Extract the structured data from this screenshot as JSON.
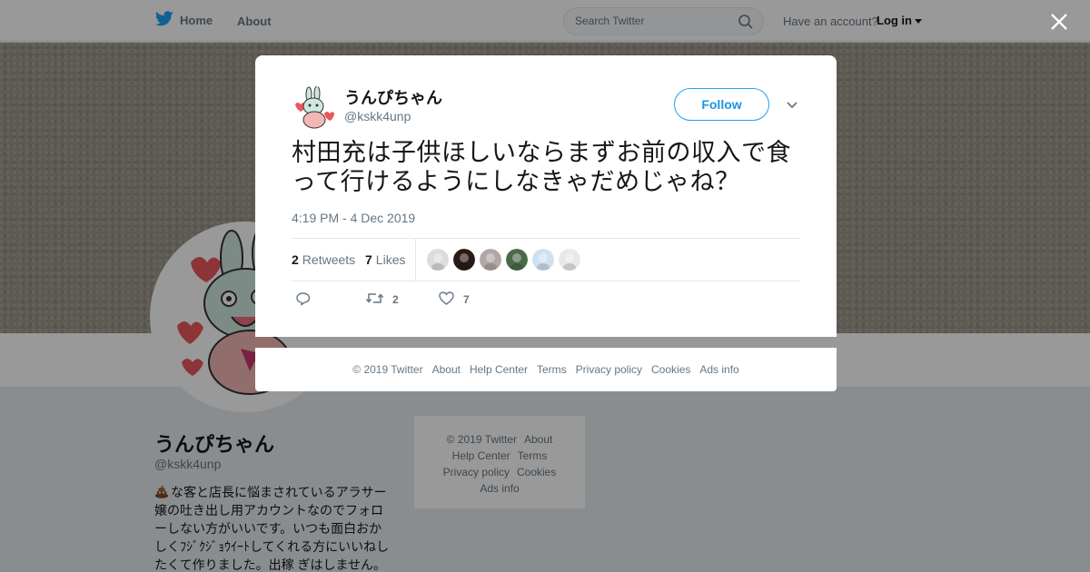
{
  "topbar": {
    "home_label": "Home",
    "about_label": "About",
    "search_placeholder": "Search Twitter",
    "account_prompt": "Have an account?",
    "login_label": "Log in"
  },
  "profile": {
    "name": "うんぴちゃん",
    "handle": "@kskk4unp",
    "bio": "な客と店長に悩まされているアラサー嬢の吐き出し用アカウントなのでフォローしない方がいいです。いつも面白おかしくﾌｼﾞｸｼﾞｮｳｲｰﾄしてくれる方にいいねしたくて作りました。出稼 ぎはしません。"
  },
  "side_footer": {
    "rows": [
      [
        "© 2019 Twitter",
        "About"
      ],
      [
        "Help Center",
        "Terms"
      ],
      [
        "Privacy policy",
        "Cookies"
      ],
      [
        "Ads info"
      ]
    ]
  },
  "tweet": {
    "author_name": "うんぴちゃん",
    "author_handle": "@kskk4unp",
    "follow_label": "Follow",
    "text": "村田充は子供ほしいならまずお前の収入で食って行けるようにしなきゃだめじゃね？",
    "timestamp": "4:19 PM - 4 Dec 2019",
    "retweets_count": "2",
    "retweets_label": "Retweets",
    "likes_count": "7",
    "likes_label": "Likes",
    "actions": {
      "retweet_count": "2",
      "like_count": "7"
    },
    "liker_colors": [
      "#dcdcdc",
      "#2a1a14",
      "#b0a6a6",
      "#4a6a4a",
      "#cfe0f0",
      "#e8e8e8"
    ]
  },
  "modal_footer": {
    "links": [
      "© 2019 Twitter",
      "About",
      "Help Center",
      "Terms",
      "Privacy policy",
      "Cookies",
      "Ads info"
    ]
  },
  "colors": {
    "brand": "#1da1f2",
    "text": "#14171a",
    "muted": "#657786"
  }
}
